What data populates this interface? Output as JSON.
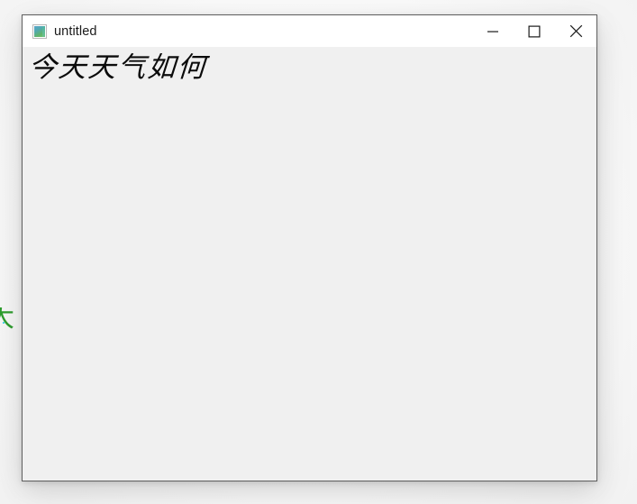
{
  "desktop": {
    "background_color": "#fafafa",
    "stray_text": "大",
    "stray_text_color": "#2f9e2f",
    "stray_dot_color": "#4dd6e6"
  },
  "window": {
    "title": "untitled",
    "icon": "image-frame-icon",
    "border_color": "#5e5e5e",
    "titlebar_background": "#ffffff",
    "content_background": "#f0f0f0",
    "controls": {
      "minimize_label": "—",
      "maximize_label": "□",
      "close_label": "✕"
    },
    "content": {
      "text": "今天天气如何",
      "text_color": "#0b0b0b"
    }
  }
}
